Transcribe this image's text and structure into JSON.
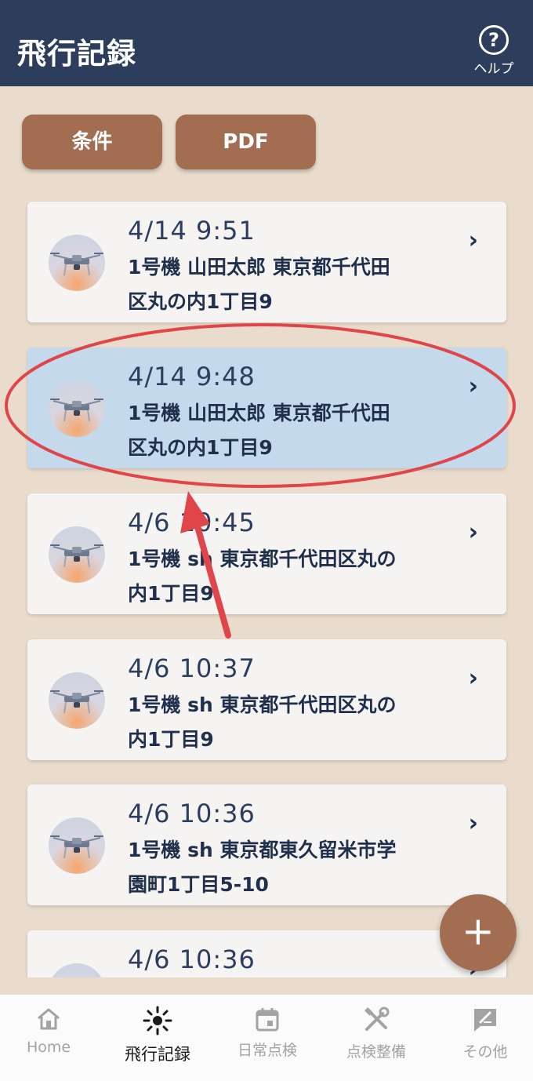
{
  "header": {
    "title": "飛行記録",
    "help_label": "ヘルプ"
  },
  "actions": {
    "conditions_label": "条件",
    "pdf_label": "PDF"
  },
  "records": [
    {
      "date": "4/14 9:51",
      "detail_line1": "1号機 山田太郎 東京都千代田",
      "detail_line2": "区丸の内1丁目9",
      "selected": false
    },
    {
      "date": "4/14 9:48",
      "detail_line1": "1号機 山田太郎 東京都千代田",
      "detail_line2": "区丸の内1丁目9",
      "selected": true
    },
    {
      "date": "4/6 10:45",
      "detail_line1": "1号機 sh 東京都千代田区丸の",
      "detail_line2": "内1丁目9",
      "selected": false
    },
    {
      "date": "4/6 10:37",
      "detail_line1": "1号機 sh 東京都千代田区丸の",
      "detail_line2": "内1丁目9",
      "selected": false
    },
    {
      "date": "4/6 10:36",
      "detail_line1": "1号機 sh 東京都東久留米市学",
      "detail_line2": "園町1丁目5-10",
      "selected": false
    },
    {
      "date": "4/6 10:36",
      "detail_line1": "",
      "detail_line2": "",
      "selected": false
    }
  ],
  "fab": {
    "icon": "plus-icon"
  },
  "tabbar": {
    "home": "Home",
    "flight_log": "飛行記録",
    "daily_check": "日常点検",
    "maintenance": "点検整備",
    "other": "その他"
  },
  "colors": {
    "header": "#2c3e5c",
    "background": "#e9dccd",
    "accent": "#a26d51",
    "selected_row": "#c4d9eb",
    "annotation": "#e0454a"
  }
}
